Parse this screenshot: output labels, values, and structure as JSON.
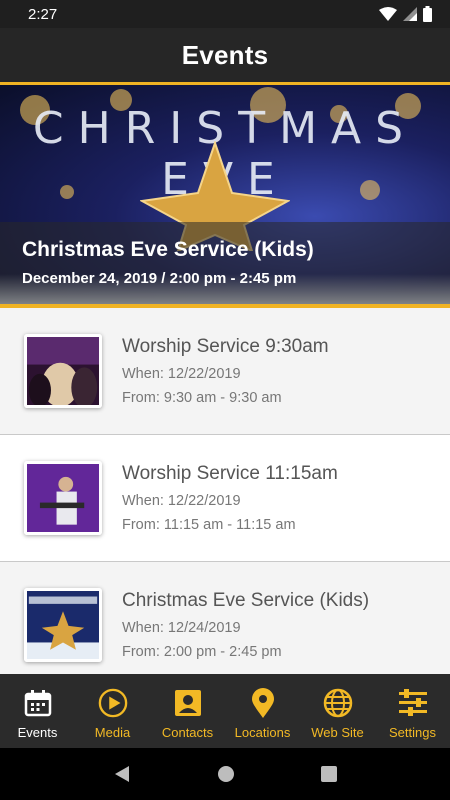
{
  "status": {
    "time": "2:27"
  },
  "header": {
    "title": "Events"
  },
  "hero": {
    "banner_text": "CHRISTMAS EVE",
    "title": "Christmas Eve Service (Kids)",
    "subtitle": "December 24, 2019 / 2:00 pm - 2:45 pm"
  },
  "events": [
    {
      "name": "Worship Service 9:30am",
      "when": "When: 12/22/2019",
      "from": "From: 9:30 am - 9:30 am"
    },
    {
      "name": "Worship Service 11:15am",
      "when": "When: 12/22/2019",
      "from": "From: 11:15 am - 11:15 am"
    },
    {
      "name": "Christmas Eve Service (Kids)",
      "when": "When: 12/24/2019",
      "from": "From: 2:00 pm - 2:45 pm"
    }
  ],
  "tabs": [
    {
      "label": "Events",
      "icon": "calendar-icon",
      "active": true
    },
    {
      "label": "Media",
      "icon": "play-icon"
    },
    {
      "label": "Contacts",
      "icon": "contact-icon"
    },
    {
      "label": "Locations",
      "icon": "map-pin-icon"
    },
    {
      "label": "Web Site",
      "icon": "globe-icon"
    },
    {
      "label": "Settings",
      "icon": "sliders-icon"
    }
  ],
  "colors": {
    "accent": "#f2b925",
    "header_bg": "#262626",
    "tab_bg": "#2b2b2b"
  }
}
